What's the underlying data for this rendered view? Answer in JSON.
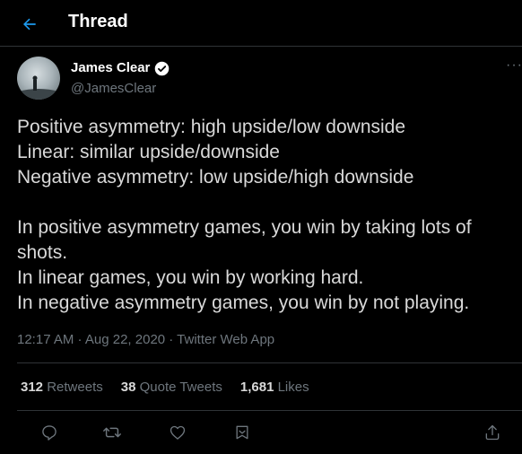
{
  "header": {
    "title": "Thread",
    "back_icon": "arrow-left-icon",
    "accent": "#1d9bf0"
  },
  "author": {
    "name": "James Clear",
    "handle": "@JamesClear",
    "verified_icon": "verified-badge-icon",
    "more_icon": "more-horizontal-icon"
  },
  "tweet": {
    "lines": [
      "Positive asymmetry: high upside/low downside",
      "Linear: similar upside/downside",
      "Negative asymmetry: low upside/high downside",
      "",
      "In positive asymmetry games, you win by taking lots of",
      "shots.",
      "In linear games, you win by working hard.",
      "In negative asymmetry games, you win by not playing."
    ],
    "timestamp": "12:17 AM · Aug 22, 2020 · Twitter Web App"
  },
  "stats": {
    "retweets_count": "312",
    "retweets_label": "Retweets",
    "quotes_count": "38",
    "quotes_label": "Quote Tweets",
    "likes_count": "1,681",
    "likes_label": "Likes"
  },
  "actions": [
    "reply-icon",
    "retweet-icon",
    "like-icon",
    "bookmark-icon",
    "share-icon"
  ],
  "colors": {
    "background": "#000000",
    "text": "#d9d9d9",
    "muted": "#6e767d",
    "border": "#2f3336"
  }
}
